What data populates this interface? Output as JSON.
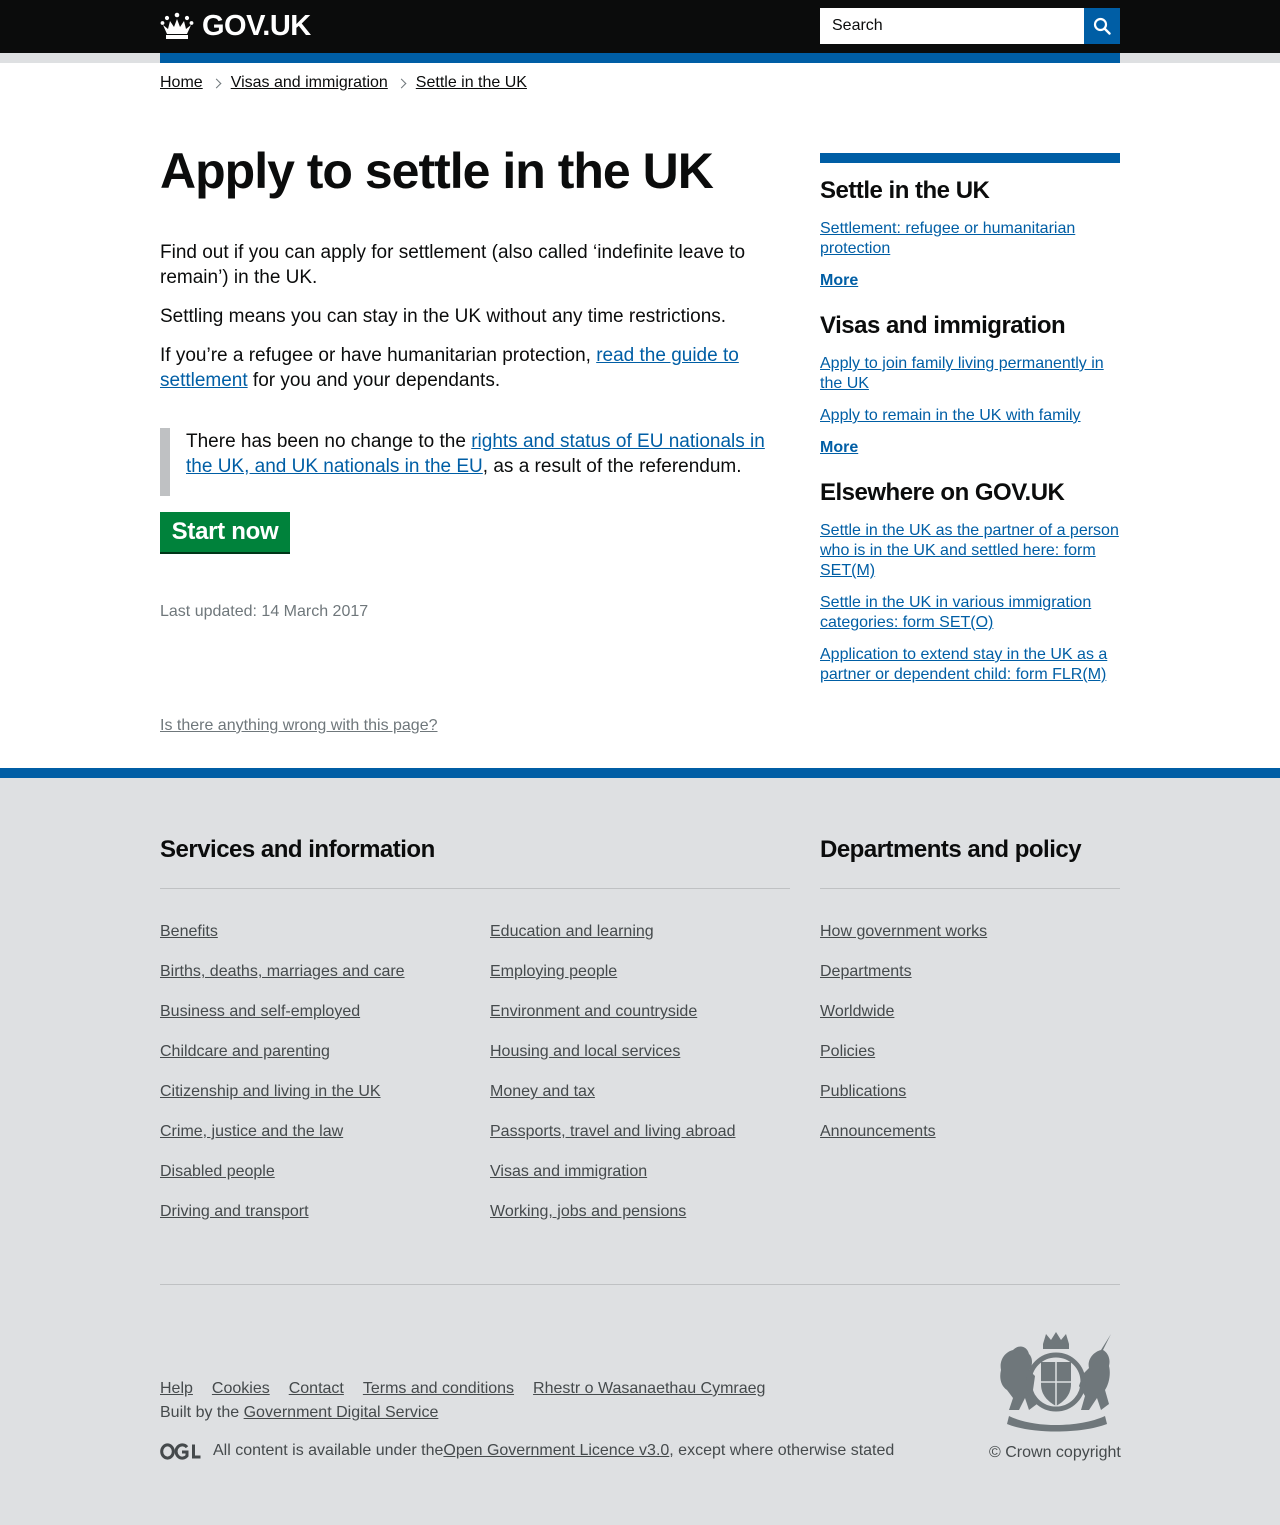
{
  "header": {
    "logo_text": "GOV.UK",
    "search_placeholder": "Search"
  },
  "breadcrumb": [
    "Home",
    "Visas and immigration",
    "Settle in the UK"
  ],
  "main": {
    "title": "Apply to settle in the UK",
    "para1": "Find out if you can apply for settlement (also called ‘indefinite leave to remain’) in the UK.",
    "para2": "Settling means you can stay in the UK without any time restrictions.",
    "para3_before": "If you’re a refugee or have humanitarian protection, ",
    "para3_link": "read the guide to settlement",
    "para3_after": " for you and your dependants.",
    "inset_before": "There has been no change to the ",
    "inset_link": "rights and status of EU nationals in the UK, and UK nationals in the EU",
    "inset_after": ", as a result of the referendum.",
    "start_button": "Start now",
    "last_updated": "Last updated: 14 March 2017",
    "report_link": "Is there anything wrong with this page?"
  },
  "sidebar": {
    "sections": [
      {
        "heading": "Settle in the UK",
        "links": [
          "Settlement: refugee or humanitarian protection"
        ],
        "more": "More"
      },
      {
        "heading": "Visas and immigration",
        "links": [
          "Apply to join family living permanently in the UK",
          "Apply to remain in the UK with family"
        ],
        "more": "More"
      },
      {
        "heading": "Elsewhere on GOV.UK",
        "links": [
          "Settle in the UK as the partner of a person who is in the UK and settled here: form SET(M)",
          "Settle in the UK in various immigration categories: form SET(O)",
          "Application to extend stay in the UK as a partner or dependent child: form FLR(M)"
        ]
      }
    ]
  },
  "footer": {
    "services_heading": "Services and information",
    "services_col1": [
      "Benefits",
      "Births, deaths, marriages and care",
      "Business and self-employed",
      "Childcare and parenting",
      "Citizenship and living in the UK",
      "Crime, justice and the law",
      "Disabled people",
      "Driving and transport"
    ],
    "services_col2": [
      "Education and learning",
      "Employing people",
      "Environment and countryside",
      "Housing and local services",
      "Money and tax",
      "Passports, travel and living abroad",
      "Visas and immigration",
      "Working, jobs and pensions"
    ],
    "departments_heading": "Departments and policy",
    "departments": [
      "How government works",
      "Departments",
      "Worldwide",
      "Policies",
      "Publications",
      "Announcements"
    ],
    "meta_links": [
      "Help",
      "Cookies",
      "Contact",
      "Terms and conditions",
      "Rhestr o Wasanaethau Cymraeg"
    ],
    "built_by_prefix": "Built by the ",
    "built_by_link": "Government Digital Service",
    "licence_prefix": "All content is available under the ",
    "licence_link": "Open Government Licence v3.0",
    "licence_suffix": ", except where otherwise stated",
    "copyright": "© Crown copyright"
  },
  "colors": {
    "header_bg": "#0b0c0c",
    "brand_blue": "#005ea5",
    "start_green": "#00823b",
    "footer_bg": "#dee0e2"
  }
}
